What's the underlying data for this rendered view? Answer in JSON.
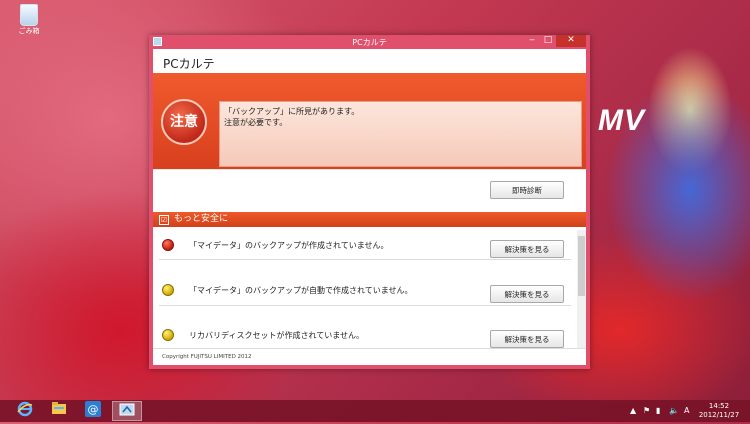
{
  "desktop": {
    "recycle_bin_label": "ごみ箱",
    "brand_logo": "MV"
  },
  "window": {
    "title": "PCカルテ",
    "controls": {
      "minimize": "‒",
      "maximize": "□",
      "close": "✕"
    }
  },
  "app": {
    "title": "PCカルテ",
    "status": {
      "badge": "注意",
      "message_line1": "「バックアップ」に所見があります。",
      "message_line2": "注意が必要です。"
    },
    "diagnose_button": "即時診断",
    "section": {
      "checkbox": "☑",
      "title": "もっと安全に"
    },
    "issues": [
      {
        "severity": "red",
        "text": "「マイデータ」のバックアップが作成されていません。",
        "button": "解決策を見る"
      },
      {
        "severity": "yellow",
        "text": "「マイデータ」のバックアップが自動で作成されていません。",
        "button": "解決策を見る"
      },
      {
        "severity": "yellow",
        "text": "リカバリディスクセットが作成されていません。",
        "button": "解決策を見る"
      }
    ],
    "footer": "Copyright FUJITSU LIMITED 2012"
  },
  "taskbar": {
    "icons": [
      "ie-icon",
      "file-explorer-icon",
      "mail-icon",
      "pc-karte-icon"
    ],
    "tray": {
      "ime": "A",
      "clock_time": "14:52",
      "clock_date": "2012/11/27"
    }
  },
  "colors": {
    "accent_red": "#e05a2a",
    "window_frame": "#e0506c",
    "close_button": "#c7312b"
  }
}
